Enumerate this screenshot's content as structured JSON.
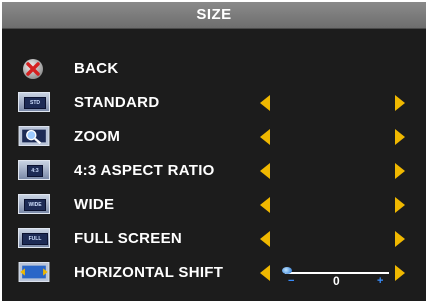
{
  "title": "SIZE",
  "colors": {
    "arrow": "#f0b800",
    "background": "#1c1c1c",
    "title_bar": "#7c7c7c",
    "slider_accent": "#3a8fff"
  },
  "menu": {
    "back": {
      "label": "BACK",
      "icon": "back-x-icon"
    },
    "items": [
      {
        "label": "STANDARD",
        "icon": "standard-screen-icon",
        "icon_text": "STD"
      },
      {
        "label": "ZOOM",
        "icon": "zoom-screen-icon",
        "icon_text": ""
      },
      {
        "label": "4:3 ASPECT RATIO",
        "icon": "aspect-ratio-icon",
        "icon_text": "4:3"
      },
      {
        "label": "WIDE",
        "icon": "wide-screen-icon",
        "icon_text": "WIDE"
      },
      {
        "label": "FULL SCREEN",
        "icon": "full-screen-icon",
        "icon_text": "FULL"
      },
      {
        "label": "HORIZONTAL SHIFT",
        "icon": "horizontal-shift-icon",
        "icon_text": ""
      }
    ]
  },
  "horizontal_shift": {
    "value": "0",
    "minus": "−",
    "plus": "+"
  }
}
